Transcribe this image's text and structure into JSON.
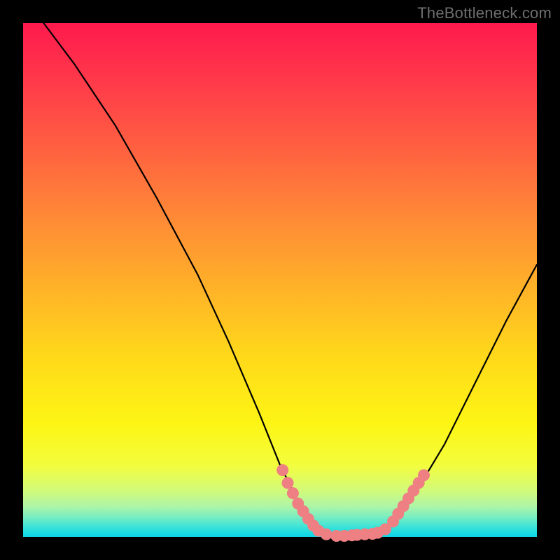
{
  "watermark": "TheBottleneck.com",
  "chart_data": {
    "type": "line",
    "title": "",
    "xlabel": "",
    "ylabel": "",
    "xlim": [
      0,
      100
    ],
    "ylim": [
      0,
      100
    ],
    "series": [
      {
        "name": "bottleneck-curve",
        "x": [
          4,
          10,
          18,
          26,
          34,
          40,
          46,
          50,
          54,
          58,
          62,
          66,
          70,
          76,
          82,
          88,
          94,
          100
        ],
        "y": [
          100,
          92,
          80,
          66,
          51,
          38,
          24,
          14,
          6,
          1,
          0,
          0,
          1,
          8,
          18,
          30,
          42,
          53
        ]
      }
    ],
    "markers": {
      "name": "pink-dots",
      "color": "#ee7f82",
      "points": [
        {
          "x": 50.5,
          "y": 13.0
        },
        {
          "x": 51.5,
          "y": 10.5
        },
        {
          "x": 52.5,
          "y": 8.5
        },
        {
          "x": 53.5,
          "y": 6.5
        },
        {
          "x": 54.5,
          "y": 5.0
        },
        {
          "x": 55.5,
          "y": 3.5
        },
        {
          "x": 56.5,
          "y": 2.2
        },
        {
          "x": 57.5,
          "y": 1.2
        },
        {
          "x": 59.0,
          "y": 0.5
        },
        {
          "x": 61.0,
          "y": 0.2
        },
        {
          "x": 62.5,
          "y": 0.2
        },
        {
          "x": 64.0,
          "y": 0.3
        },
        {
          "x": 65.0,
          "y": 0.4
        },
        {
          "x": 66.5,
          "y": 0.5
        },
        {
          "x": 68.0,
          "y": 0.6
        },
        {
          "x": 69.0,
          "y": 0.8
        },
        {
          "x": 70.5,
          "y": 1.5
        },
        {
          "x": 72.0,
          "y": 3.0
        },
        {
          "x": 73.0,
          "y": 4.5
        },
        {
          "x": 74.0,
          "y": 6.0
        },
        {
          "x": 75.0,
          "y": 7.5
        },
        {
          "x": 76.0,
          "y": 9.0
        },
        {
          "x": 77.0,
          "y": 10.5
        },
        {
          "x": 78.0,
          "y": 12.0
        }
      ]
    }
  }
}
